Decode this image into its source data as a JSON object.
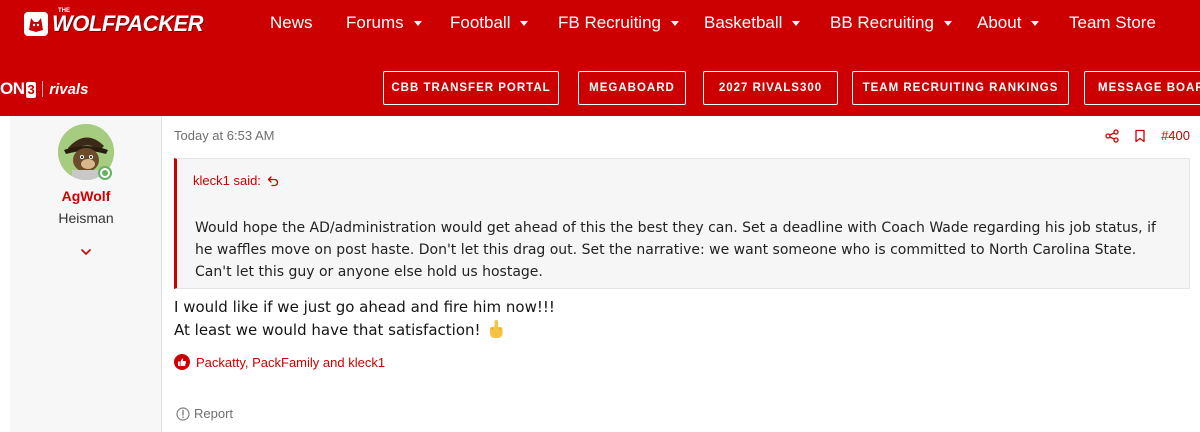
{
  "header": {
    "logo_text": "WOLFPACKER",
    "logo_sup": "THE",
    "nav": [
      {
        "label": "News",
        "has_dropdown": false
      },
      {
        "label": "Forums",
        "has_dropdown": true
      },
      {
        "label": "Football",
        "has_dropdown": true
      },
      {
        "label": "FB Recruiting",
        "has_dropdown": true
      },
      {
        "label": "Basketball",
        "has_dropdown": true
      },
      {
        "label": "BB Recruiting",
        "has_dropdown": true
      },
      {
        "label": "About",
        "has_dropdown": true
      },
      {
        "label": "Team Store",
        "has_dropdown": false
      }
    ],
    "network": {
      "on3_text": "ON",
      "on3_box": "3",
      "rivals": "rivals"
    },
    "quick_links": [
      "CBB TRANSFER PORTAL",
      "MEGABOARD",
      "2027 RIVALS300",
      "TEAM RECRUITING RANKINGS",
      "MESSAGE BOARD"
    ],
    "colors": {
      "brand": "#cc0000",
      "text_on_brand": "#ffffff"
    }
  },
  "post": {
    "author": {
      "name": "AgWolf",
      "title": "Heisman",
      "online": true
    },
    "date": "Today at 6:53 AM",
    "post_number": "#400",
    "quote": {
      "author_label": "kleck1 said:",
      "text": "Would hope the AD/administration would get ahead of this the best they can. Set a deadline with Coach Wade regarding his job status, if he waffles move on post haste. Don't let this drag out. Set the narrative: we want someone who is committed to North Carolina State. Can't let this guy or anyone else hold us hostage."
    },
    "message_lines": [
      "I would like if we just go ahead and fire him now!!!",
      "At least we would have that satisfaction!"
    ],
    "reactions_text": "Packatty, PackFamily and kleck1",
    "report_label": "Report",
    "icons": [
      "share-icon",
      "bookmark-icon",
      "reply-arrow-icon",
      "like-icon",
      "warning-icon",
      "chevron-down-icon",
      "middle-finger-emoji-icon"
    ]
  }
}
